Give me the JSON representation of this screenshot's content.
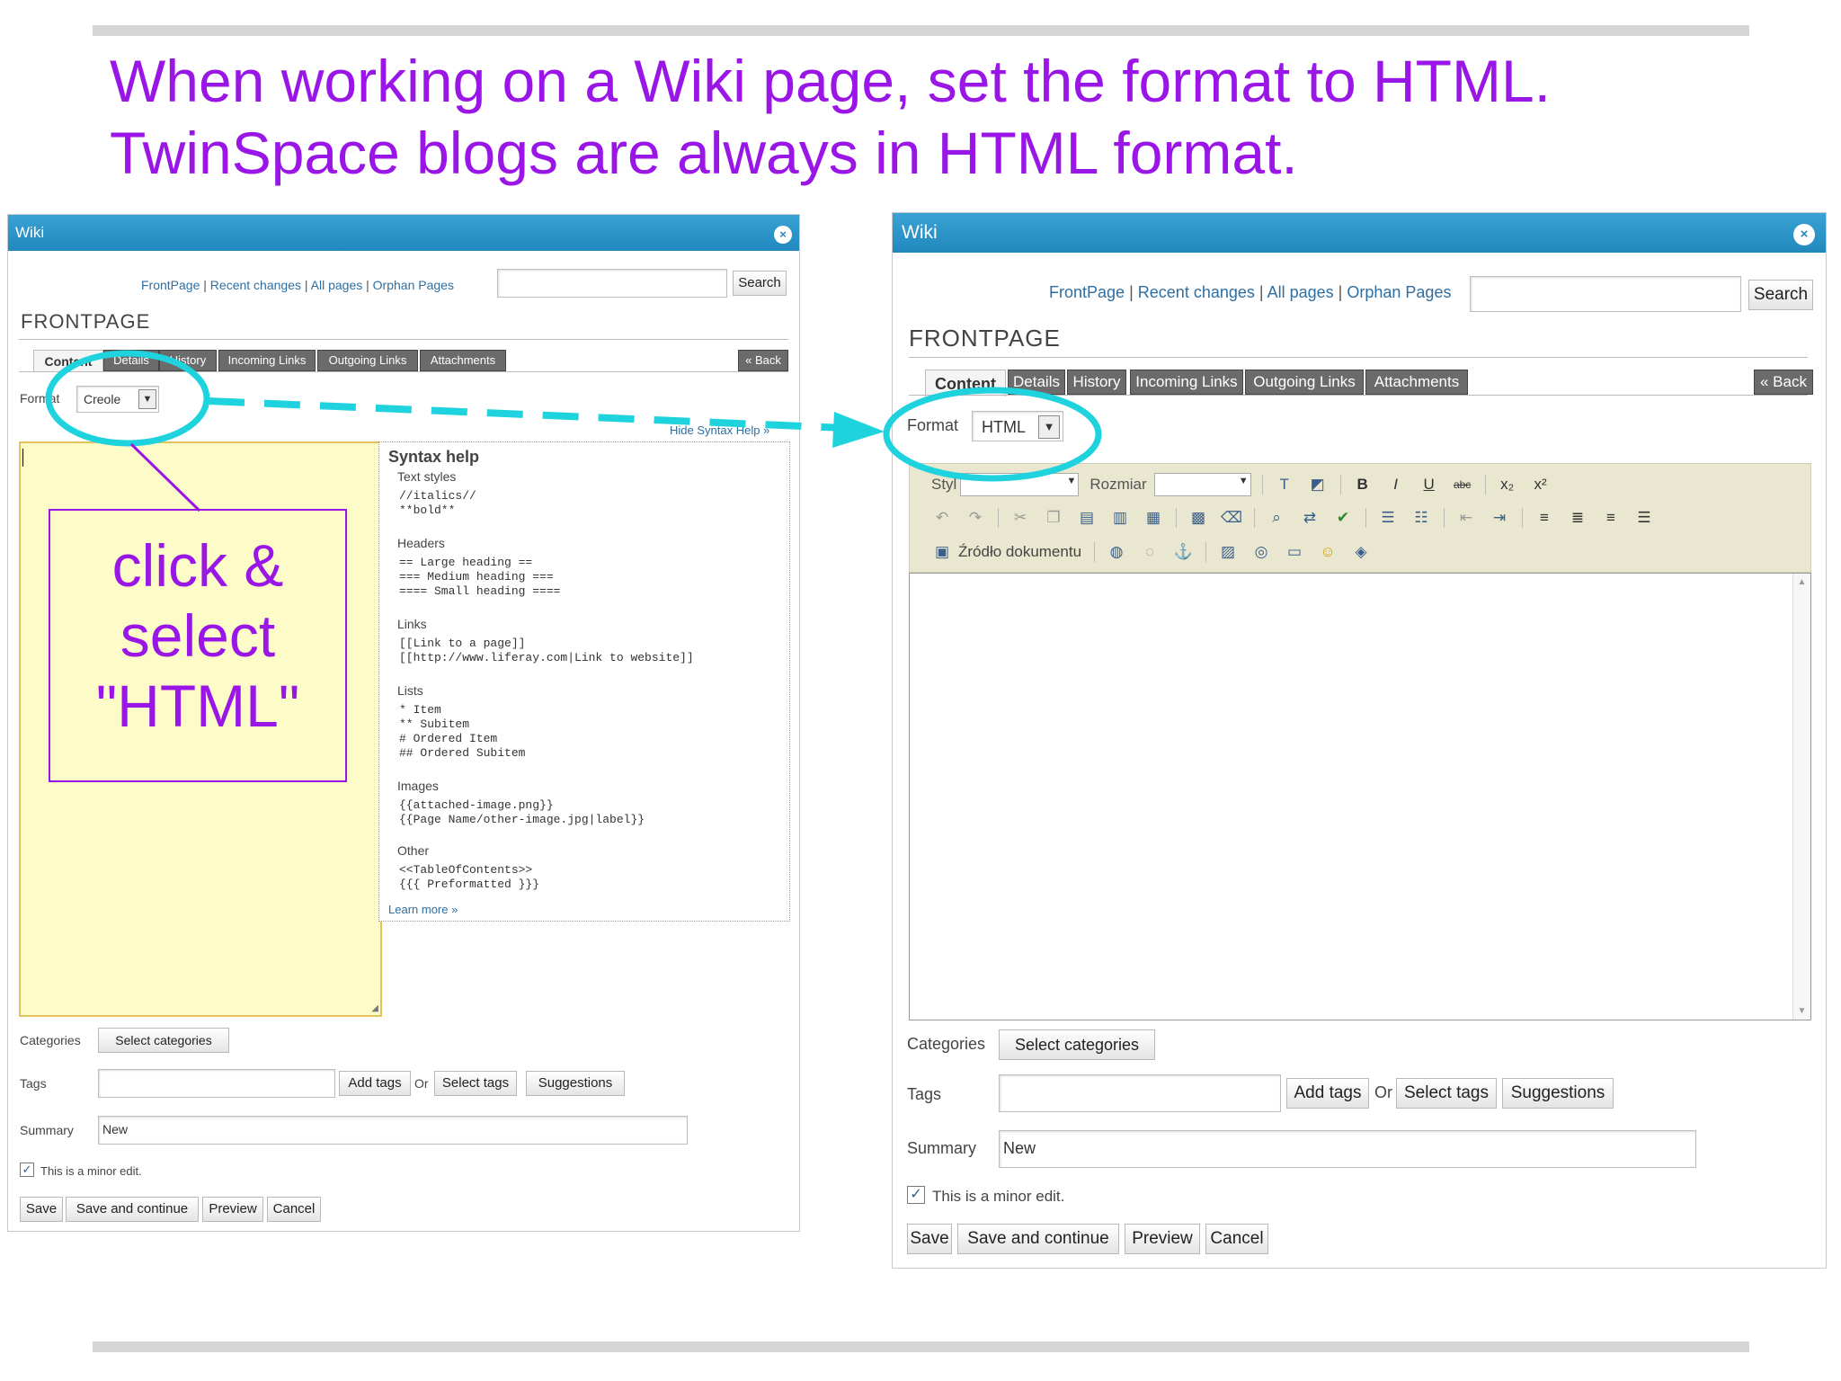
{
  "slide": {
    "title_line1": "When working on a Wiki page, set the format to HTML.",
    "title_line2": "TwinSpace blogs are always in HTML format.",
    "callout_line1": "click &",
    "callout_line2": "select",
    "callout_line3": "\"HTML\""
  },
  "colors": {
    "title": "#9a16e6",
    "callout_border": "#9a16e6",
    "highlight": "#1fd3de",
    "window_header": "#2a96c9"
  },
  "left_window": {
    "title": "Wiki",
    "close": "×",
    "nav": {
      "front": "FrontPage",
      "recent": "Recent changes",
      "all": "All pages",
      "orphan": "Orphan Pages",
      "sep": "|"
    },
    "search_button": "Search",
    "page_title": "FRONTPAGE",
    "tabs": [
      "Content",
      "Details",
      "History",
      "Incoming Links",
      "Outgoing Links",
      "Attachments"
    ],
    "back": "« Back",
    "format_label": "Format",
    "format_value": "Creole",
    "hide_syntax": "Hide Syntax Help »",
    "syntax": {
      "title": "Syntax help",
      "text_styles": "Text styles",
      "text_styles_code": "//italics//\n**bold**",
      "headers": "Headers",
      "headers_code": "== Large heading ==\n=== Medium heading ===\n==== Small heading ====",
      "links": "Links",
      "links_code": "[[Link to a page]]\n[[http://www.liferay.com|Link to website]]",
      "lists": "Lists",
      "lists_code": "* Item\n** Subitem\n# Ordered Item\n## Ordered Subitem",
      "images": "Images",
      "images_code": "{{attached-image.png}}\n{{Page Name/other-image.jpg|label}}",
      "other": "Other",
      "other_code": "<<TableOfContents>>\n{{{ Preformatted }}}",
      "learn_more": "Learn more »"
    },
    "categories_label": "Categories",
    "select_categories": "Select categories",
    "tags_label": "Tags",
    "add_tags": "Add tags",
    "or": "Or",
    "select_tags": "Select tags",
    "suggestions": "Suggestions",
    "summary_label": "Summary",
    "summary_value": "New",
    "minor_edit": "This is a minor edit.",
    "save": "Save",
    "save_continue": "Save and continue",
    "preview": "Preview",
    "cancel": "Cancel"
  },
  "right_window": {
    "title": "Wiki",
    "close": "×",
    "nav": {
      "front": "FrontPage",
      "recent": "Recent changes",
      "all": "All pages",
      "orphan": "Orphan Pages",
      "sep": "|"
    },
    "search_button": "Search",
    "page_title": "FRONTPAGE",
    "tabs": [
      "Content",
      "Details",
      "History",
      "Incoming Links",
      "Outgoing Links",
      "Attachments"
    ],
    "back": "« Back",
    "format_label": "Format",
    "format_value": "HTML",
    "editor": {
      "style_label": "Styl",
      "size_label": "Rozmiar",
      "source_label": "Źródło dokumentu",
      "icons_row1": [
        "text-color-icon",
        "bg-color-icon",
        "bold-icon",
        "italic-icon",
        "underline-icon",
        "strike-icon",
        "subscript-icon",
        "superscript-icon"
      ],
      "icons_row2": [
        "undo-icon",
        "redo-icon",
        "cut-icon",
        "copy-icon",
        "paste-icon",
        "paste-text-icon",
        "paste-word-icon",
        "select-all-icon",
        "remove-format-icon",
        "find-icon",
        "replace-icon",
        "spellcheck-icon",
        "numbered-list-icon",
        "bulleted-list-icon",
        "outdent-icon",
        "indent-icon",
        "align-left-icon",
        "align-center-icon",
        "align-right-icon",
        "justify-icon"
      ],
      "icons_row3": [
        "source-icon",
        "link-icon",
        "unlink-icon",
        "anchor-icon",
        "image-icon",
        "flash-icon",
        "table-icon",
        "smiley-icon",
        "special-char-icon"
      ]
    },
    "categories_label": "Categories",
    "select_categories": "Select categories",
    "tags_label": "Tags",
    "add_tags": "Add tags",
    "or": "Or",
    "select_tags": "Select tags",
    "suggestions": "Suggestions",
    "summary_label": "Summary",
    "summary_value": "New",
    "minor_edit": "This is a minor edit.",
    "save": "Save",
    "save_continue": "Save and continue",
    "preview": "Preview",
    "cancel": "Cancel"
  }
}
